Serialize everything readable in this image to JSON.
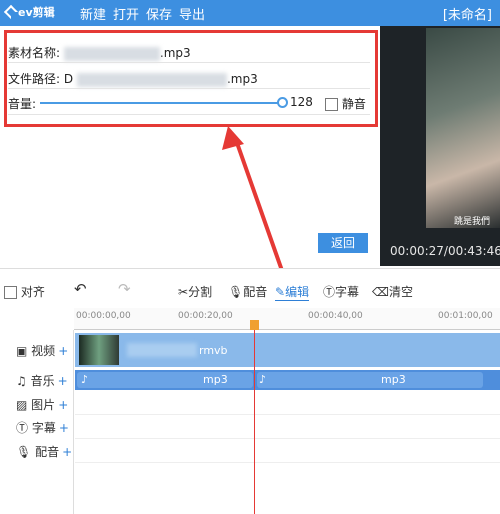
{
  "app": {
    "logo": "ev剪辑",
    "title": "[未命名]"
  },
  "menu": [
    "新建",
    "打开",
    "保存",
    "导出"
  ],
  "properties": {
    "name_label": "素材名称:",
    "name_value": ".mp3",
    "path_label": "文件路径:",
    "path_prefix": "D",
    "path_value": ".mp3",
    "volume_label": "音量:",
    "volume_value": "128",
    "mute_label": "静音",
    "back_button": "返回"
  },
  "preview": {
    "subtitle": "跳是我們",
    "timecode": "00:00:27/00:43:46"
  },
  "toolbar": {
    "align": "对齐",
    "undo_icon": "undo-icon",
    "redo_icon": "redo-icon",
    "split": "分割",
    "dub": "配音",
    "edit": "编辑",
    "caption": "字幕",
    "clear": "清空"
  },
  "ruler": [
    "00:00:00,00",
    "00:00:20,00",
    "00:00:40,00",
    "00:01:00,00"
  ],
  "tracks": [
    {
      "label": "视频",
      "icon": "video-icon"
    },
    {
      "label": "音乐",
      "icon": "music-icon"
    },
    {
      "label": "图片",
      "icon": "image-icon"
    },
    {
      "label": "字幕",
      "icon": "caption-icon"
    },
    {
      "label": "配音",
      "icon": "mic-icon"
    }
  ],
  "clips": {
    "video_name": "rmvb",
    "audio_1": "mp3",
    "audio_2": "mp3"
  },
  "colors": {
    "accent": "#3d8fe0",
    "annotation": "#e53935",
    "video_clip": "#8ab9ea",
    "audio_track": "#4f8edc"
  }
}
